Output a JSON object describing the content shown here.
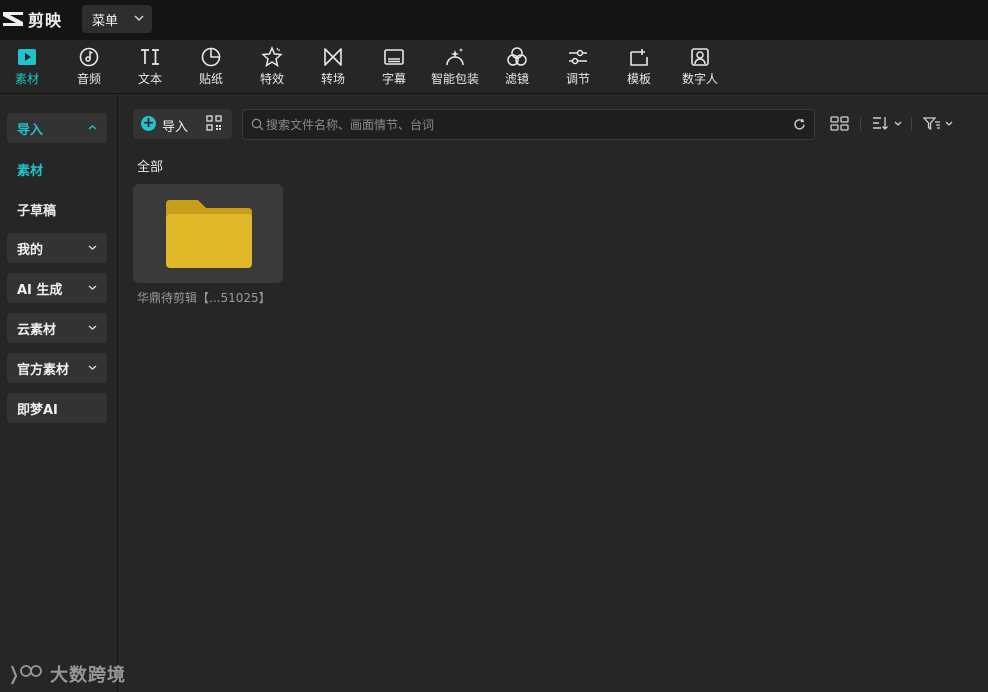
{
  "app": {
    "name": "剪映",
    "menu_label": "菜单"
  },
  "toolbar": {
    "tools": [
      {
        "label": "素材",
        "icon": "media-icon",
        "active": true
      },
      {
        "label": "音频",
        "icon": "audio-icon"
      },
      {
        "label": "文本",
        "icon": "text-icon"
      },
      {
        "label": "贴纸",
        "icon": "sticker-icon"
      },
      {
        "label": "特效",
        "icon": "effects-icon"
      },
      {
        "label": "转场",
        "icon": "transition-icon"
      },
      {
        "label": "字幕",
        "icon": "subtitle-icon"
      },
      {
        "label": "智能包装",
        "icon": "smart-package-icon"
      },
      {
        "label": "滤镜",
        "icon": "filter-icon"
      },
      {
        "label": "调节",
        "icon": "adjust-icon"
      },
      {
        "label": "模板",
        "icon": "template-icon"
      },
      {
        "label": "数字人",
        "icon": "digital-human-icon"
      }
    ]
  },
  "sidebar": {
    "import_label": "导入",
    "sub_items": [
      "素材",
      "子草稿"
    ],
    "groups": [
      "我的",
      "AI 生成",
      "云素材",
      "官方素材"
    ],
    "jimeng_label": "即梦AI"
  },
  "main": {
    "import_button": "导入",
    "search_placeholder": "搜索文件名称、画面情节、台词",
    "section_label": "全部",
    "folder_name": "华鼎待剪辑【...51025】"
  },
  "watermark": {
    "text": "大数跨境"
  },
  "colors": {
    "accent": "#20c4cb",
    "folder": "#e0b829",
    "background": "#262626",
    "titlebar": "#141414"
  }
}
